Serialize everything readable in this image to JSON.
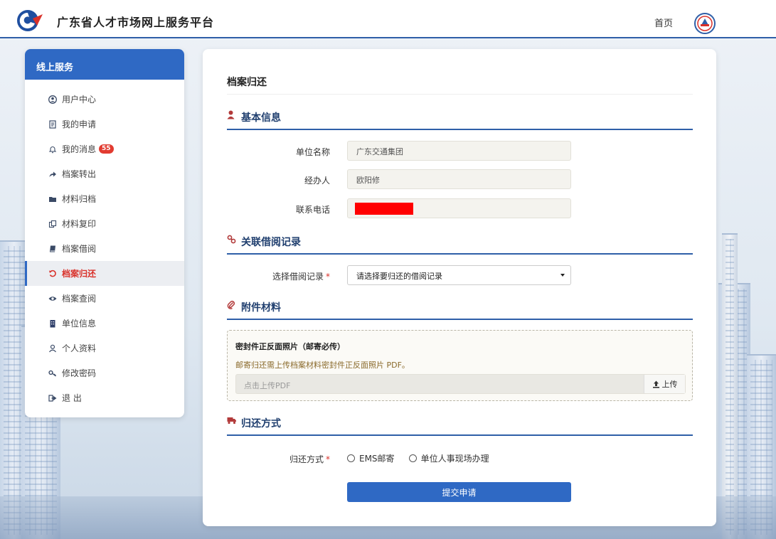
{
  "header": {
    "site_title": "广东省人才市场网上服务平台",
    "nav_home": "首页",
    "logo_icon": "gd-talent-logo-icon",
    "avatar_icon": "user-avatar-icon"
  },
  "sidebar": {
    "title": "线上服务",
    "items": [
      {
        "label": "用户中心",
        "icon": "user-circle-icon"
      },
      {
        "label": "我的申请",
        "icon": "document-icon"
      },
      {
        "label": "我的消息",
        "icon": "bell-icon",
        "badge": "55"
      },
      {
        "label": "档案转出",
        "icon": "share-arrow-icon"
      },
      {
        "label": "材料归档",
        "icon": "folder-icon"
      },
      {
        "label": "材料复印",
        "icon": "copy-icon"
      },
      {
        "label": "档案借阅",
        "icon": "book-icon"
      },
      {
        "label": "档案归还",
        "icon": "undo-icon",
        "active": true
      },
      {
        "label": "档案查阅",
        "icon": "eye-icon"
      },
      {
        "label": "单位信息",
        "icon": "building-icon"
      },
      {
        "label": "个人资料",
        "icon": "person-icon"
      },
      {
        "label": "修改密码",
        "icon": "key-icon"
      },
      {
        "label": "退 出",
        "icon": "logout-icon"
      }
    ]
  },
  "main": {
    "page_title": "档案归还",
    "sections": {
      "basic": {
        "title": "基本信息",
        "icon": "user-icon"
      },
      "borrow": {
        "title": "关联借阅记录",
        "icon": "link-icon"
      },
      "attach": {
        "title": "附件材料",
        "icon": "paperclip-icon"
      },
      "return": {
        "title": "归还方式",
        "icon": "truck-icon"
      }
    },
    "fields": {
      "unit_name_label": "单位名称",
      "unit_name_value": "广东交通集团",
      "handler_label": "经办人",
      "handler_value": "欧阳修",
      "phone_label": "联系电话",
      "borrow_label": "选择借阅记录",
      "borrow_placeholder": "请选择要归还的借阅记录",
      "return_label": "归还方式"
    },
    "attachment": {
      "title": "密封件正反面照片（邮寄必传）",
      "hint": "邮寄归还需上传档案材料密封件正反面照片 PDF。",
      "placeholder": "点击上传PDF",
      "button": "上传"
    },
    "return_options": [
      "EMS邮寄",
      "单位人事现场办理"
    ],
    "submit": "提交申请"
  },
  "colors": {
    "primary": "#2f69c4",
    "header_border": "#2f5fa8",
    "active_text": "#d9312a",
    "redaction": "#ff0000"
  }
}
